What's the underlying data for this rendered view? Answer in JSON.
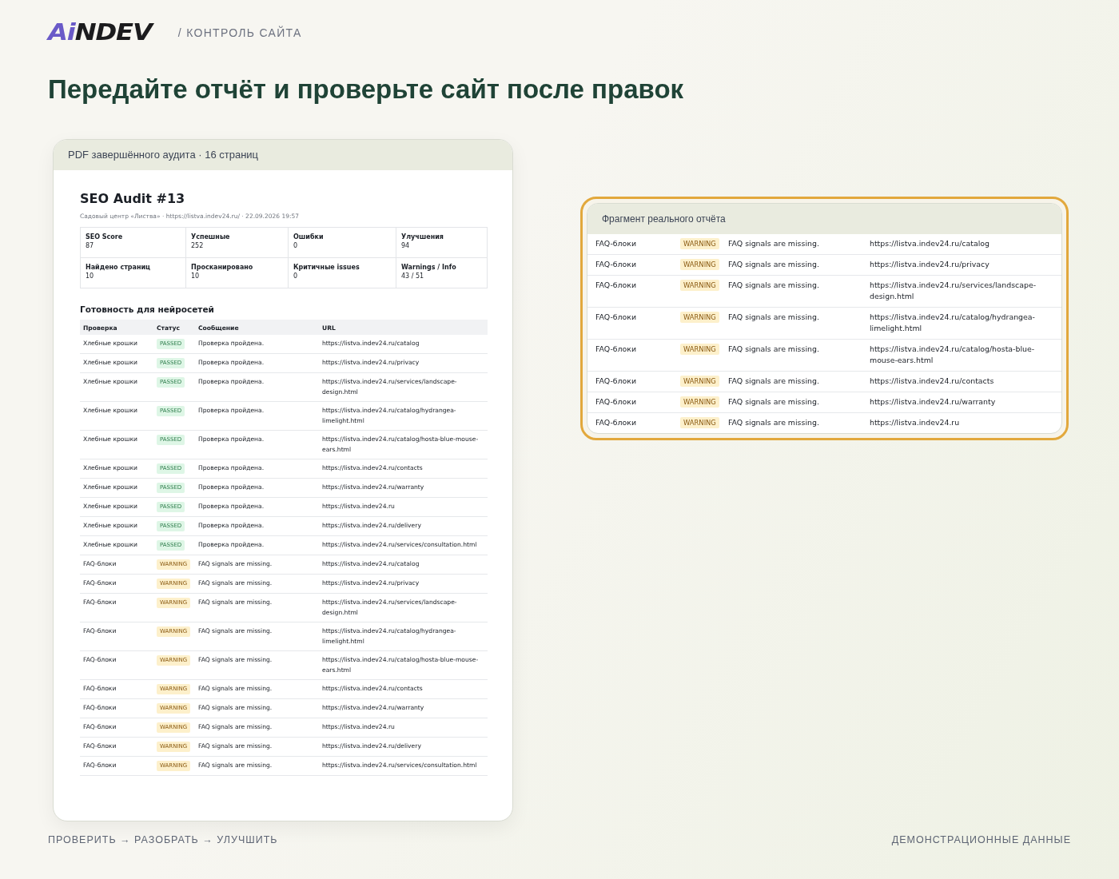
{
  "header": {
    "logo_accent": "Ai",
    "logo_rest": "NDEV",
    "section": "/ КОНТРОЛЬ САЙТА"
  },
  "headline": "Передайте отчёт и проверьте сайт после правок",
  "pdf_card": {
    "caption": "PDF завершённого аудита · 16 страниц",
    "report": {
      "title": "SEO Audit #13",
      "meta": "Садовый центр «Листва» · https://listva.indev24.ru/ · 22.09.2026 19:57",
      "stats": [
        {
          "label": "SEO Score",
          "value": "87"
        },
        {
          "label": "Успешные",
          "value": "252"
        },
        {
          "label": "Ошибки",
          "value": "0"
        },
        {
          "label": "Улучшения",
          "value": "94"
        },
        {
          "label": "Найдено страниц",
          "value": "10"
        },
        {
          "label": "Просканировано",
          "value": "10"
        },
        {
          "label": "Критичные issues",
          "value": "0"
        },
        {
          "label": "Warnings / Info",
          "value": "43 / 51"
        }
      ],
      "section_title": "Готовность для нейросетей",
      "columns": [
        "Проверка",
        "Статус",
        "Сообщение",
        "URL"
      ],
      "rows": [
        {
          "check": "Хлебные крошки",
          "status": "PASSED",
          "kind": "passed",
          "message": "Проверка пройдена.",
          "url": "https://listva.indev24.ru/catalog"
        },
        {
          "check": "Хлебные крошки",
          "status": "PASSED",
          "kind": "passed",
          "message": "Проверка пройдена.",
          "url": "https://listva.indev24.ru/privacy"
        },
        {
          "check": "Хлебные крошки",
          "status": "PASSED",
          "kind": "passed",
          "message": "Проверка пройдена.",
          "url": "https://listva.indev24.ru/services/landscape-design.html"
        },
        {
          "check": "Хлебные крошки",
          "status": "PASSED",
          "kind": "passed",
          "message": "Проверка пройдена.",
          "url": "https://listva.indev24.ru/catalog/hydrangea-limelight.html"
        },
        {
          "check": "Хлебные крошки",
          "status": "PASSED",
          "kind": "passed",
          "message": "Проверка пройдена.",
          "url": "https://listva.indev24.ru/catalog/hosta-blue-mouse-ears.html"
        },
        {
          "check": "Хлебные крошки",
          "status": "PASSED",
          "kind": "passed",
          "message": "Проверка пройдена.",
          "url": "https://listva.indev24.ru/contacts"
        },
        {
          "check": "Хлебные крошки",
          "status": "PASSED",
          "kind": "passed",
          "message": "Проверка пройдена.",
          "url": "https://listva.indev24.ru/warranty"
        },
        {
          "check": "Хлебные крошки",
          "status": "PASSED",
          "kind": "passed",
          "message": "Проверка пройдена.",
          "url": "https://listva.indev24.ru"
        },
        {
          "check": "Хлебные крошки",
          "status": "PASSED",
          "kind": "passed",
          "message": "Проверка пройдена.",
          "url": "https://listva.indev24.ru/delivery"
        },
        {
          "check": "Хлебные крошки",
          "status": "PASSED",
          "kind": "passed",
          "message": "Проверка пройдена.",
          "url": "https://listva.indev24.ru/services/consultation.html"
        },
        {
          "check": "FAQ-блоки",
          "status": "WARNING",
          "kind": "warning",
          "message": "FAQ signals are missing.",
          "url": "https://listva.indev24.ru/catalog"
        },
        {
          "check": "FAQ-блоки",
          "status": "WARNING",
          "kind": "warning",
          "message": "FAQ signals are missing.",
          "url": "https://listva.indev24.ru/privacy"
        },
        {
          "check": "FAQ-блоки",
          "status": "WARNING",
          "kind": "warning",
          "message": "FAQ signals are missing.",
          "url": "https://listva.indev24.ru/services/landscape-design.html"
        },
        {
          "check": "FAQ-блоки",
          "status": "WARNING",
          "kind": "warning",
          "message": "FAQ signals are missing.",
          "url": "https://listva.indev24.ru/catalog/hydrangea-limelight.html"
        },
        {
          "check": "FAQ-блоки",
          "status": "WARNING",
          "kind": "warning",
          "message": "FAQ signals are missing.",
          "url": "https://listva.indev24.ru/catalog/hosta-blue-mouse-ears.html"
        },
        {
          "check": "FAQ-блоки",
          "status": "WARNING",
          "kind": "warning",
          "message": "FAQ signals are missing.",
          "url": "https://listva.indev24.ru/contacts"
        },
        {
          "check": "FAQ-блоки",
          "status": "WARNING",
          "kind": "warning",
          "message": "FAQ signals are missing.",
          "url": "https://listva.indev24.ru/warranty"
        },
        {
          "check": "FAQ-блоки",
          "status": "WARNING",
          "kind": "warning",
          "message": "FAQ signals are missing.",
          "url": "https://listva.indev24.ru"
        },
        {
          "check": "FAQ-блоки",
          "status": "WARNING",
          "kind": "warning",
          "message": "FAQ signals are missing.",
          "url": "https://listva.indev24.ru/delivery"
        },
        {
          "check": "FAQ-блоки",
          "status": "WARNING",
          "kind": "warning",
          "message": "FAQ signals are missing.",
          "url": "https://listva.indev24.ru/services/consultation.html"
        }
      ]
    }
  },
  "fragment_card": {
    "caption": "Фрагмент реального отчёта",
    "rows": [
      {
        "check": "FAQ-блоки",
        "status": "WARNING",
        "kind": "warning",
        "message": "FAQ signals are missing.",
        "url": "https://listva.indev24.ru/catalog"
      },
      {
        "check": "FAQ-блоки",
        "status": "WARNING",
        "kind": "warning",
        "message": "FAQ signals are missing.",
        "url": "https://listva.indev24.ru/privacy"
      },
      {
        "check": "FAQ-блоки",
        "status": "WARNING",
        "kind": "warning",
        "message": "FAQ signals are missing.",
        "url": "https://listva.indev24.ru/services/landscape-design.html"
      },
      {
        "check": "FAQ-блоки",
        "status": "WARNING",
        "kind": "warning",
        "message": "FAQ signals are missing.",
        "url": "https://listva.indev24.ru/catalog/hydrangea-limelight.html"
      },
      {
        "check": "FAQ-блоки",
        "status": "WARNING",
        "kind": "warning",
        "message": "FAQ signals are missing.",
        "url": "https://listva.indev24.ru/catalog/hosta-blue-mouse-ears.html"
      },
      {
        "check": "FAQ-блоки",
        "status": "WARNING",
        "kind": "warning",
        "message": "FAQ signals are missing.",
        "url": "https://listva.indev24.ru/contacts"
      },
      {
        "check": "FAQ-блоки",
        "status": "WARNING",
        "kind": "warning",
        "message": "FAQ signals are missing.",
        "url": "https://listva.indev24.ru/warranty"
      },
      {
        "check": "FAQ-блоки",
        "status": "WARNING",
        "kind": "warning",
        "message": "FAQ signals are missing.",
        "url": "https://listva.indev24.ru"
      }
    ]
  },
  "footer": {
    "left": "ПРОВЕРИТЬ → РАЗОБРАТЬ → УЛУЧШИТЬ",
    "right": "ДЕМОНСТРАЦИОННЫЕ ДАННЫЕ"
  }
}
